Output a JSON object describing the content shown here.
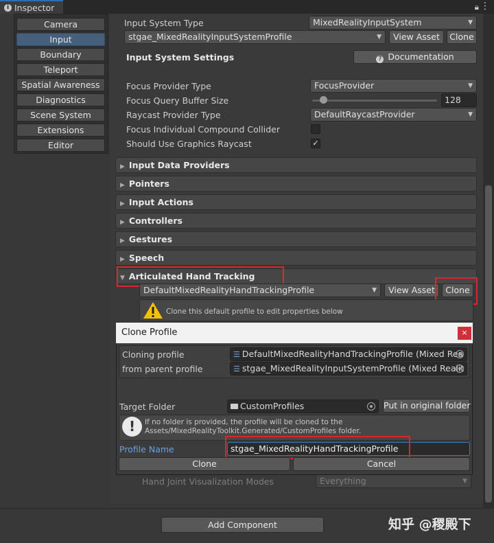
{
  "window": {
    "tab_title": "Inspector"
  },
  "sidebar": {
    "items": [
      {
        "label": "Camera"
      },
      {
        "label": "Input"
      },
      {
        "label": "Boundary"
      },
      {
        "label": "Teleport"
      },
      {
        "label": "Spatial Awareness"
      },
      {
        "label": "Diagnostics"
      },
      {
        "label": "Scene System"
      },
      {
        "label": "Extensions"
      },
      {
        "label": "Editor"
      }
    ],
    "active": "Input"
  },
  "input_system": {
    "type_label": "Input System Type",
    "type_value": "MixedRealityInputSystem",
    "profile_value": "stgae_MixedRealityInputSystemProfile",
    "view_asset": "View Asset",
    "clone": "Clone",
    "settings_title": "Input System Settings",
    "documentation": "Documentation"
  },
  "settings": {
    "focus_provider_type_label": "Focus Provider Type",
    "focus_provider_type_value": "FocusProvider",
    "focus_query_buffer_label": "Focus Query Buffer Size",
    "focus_query_buffer_value": "128",
    "focus_query_buffer_fraction": 0.06,
    "raycast_provider_label": "Raycast Provider Type",
    "raycast_provider_value": "DefaultRaycastProvider",
    "focus_individual_label": "Focus Individual Compound Collider",
    "focus_individual_checked": false,
    "graphics_raycast_label": "Should Use Graphics Raycast",
    "graphics_raycast_checked": true,
    "graphics_raycast_mark": "✓"
  },
  "foldouts": [
    {
      "label": "Input Data Providers"
    },
    {
      "label": "Pointers"
    },
    {
      "label": "Input Actions"
    },
    {
      "label": "Controllers"
    },
    {
      "label": "Gestures"
    },
    {
      "label": "Speech"
    },
    {
      "label": "Articulated Hand Tracking",
      "expanded": true
    }
  ],
  "hand_tracking": {
    "profile_value": "DefaultMixedRealityHandTrackingProfile",
    "view_asset": "View Asset",
    "clone": "Clone",
    "warning": "Clone this default profile to edit properties below",
    "joint_vis_label": "Hand Joint Visualization Modes",
    "joint_vis_value": "Everything"
  },
  "dialog": {
    "title": "Clone Profile",
    "close_glyph": "×",
    "cloning_profile_label": "Cloning profile",
    "cloning_profile_value": "DefaultMixedRealityHandTrackingProfile (Mixed Rea",
    "parent_profile_label": "from parent profile",
    "parent_profile_value": "stgae_MixedRealityInputSystemProfile (Mixed Realit",
    "target_folder_label": "Target Folder",
    "target_folder_value": "CustomProfiles",
    "put_in_original": "Put in original folder",
    "info_line1": "If no folder is provided, the profile will be cloned to the",
    "info_line2": "Assets/MixedRealityToolkit.Generated/CustomProfiles folder.",
    "profile_name_label": "Profile Name",
    "profile_name_value": "stgae_MixedRealityHandTrackingProfile",
    "clone_button": "Clone",
    "cancel_button": "Cancel"
  },
  "footer": {
    "add_component": "Add Component"
  },
  "watermark": "知乎 @稷殿下",
  "colors": {
    "highlight_red": "#e0242c",
    "active_tab_blue": "#46607c",
    "profile_name_label": "#6aa0e0"
  },
  "icons": {
    "inspector": "info-icon",
    "lock": "lock-icon",
    "menu": "kebab-icon",
    "warning": "warning-icon",
    "info": "exclamation-icon",
    "folder": "folder-icon"
  }
}
